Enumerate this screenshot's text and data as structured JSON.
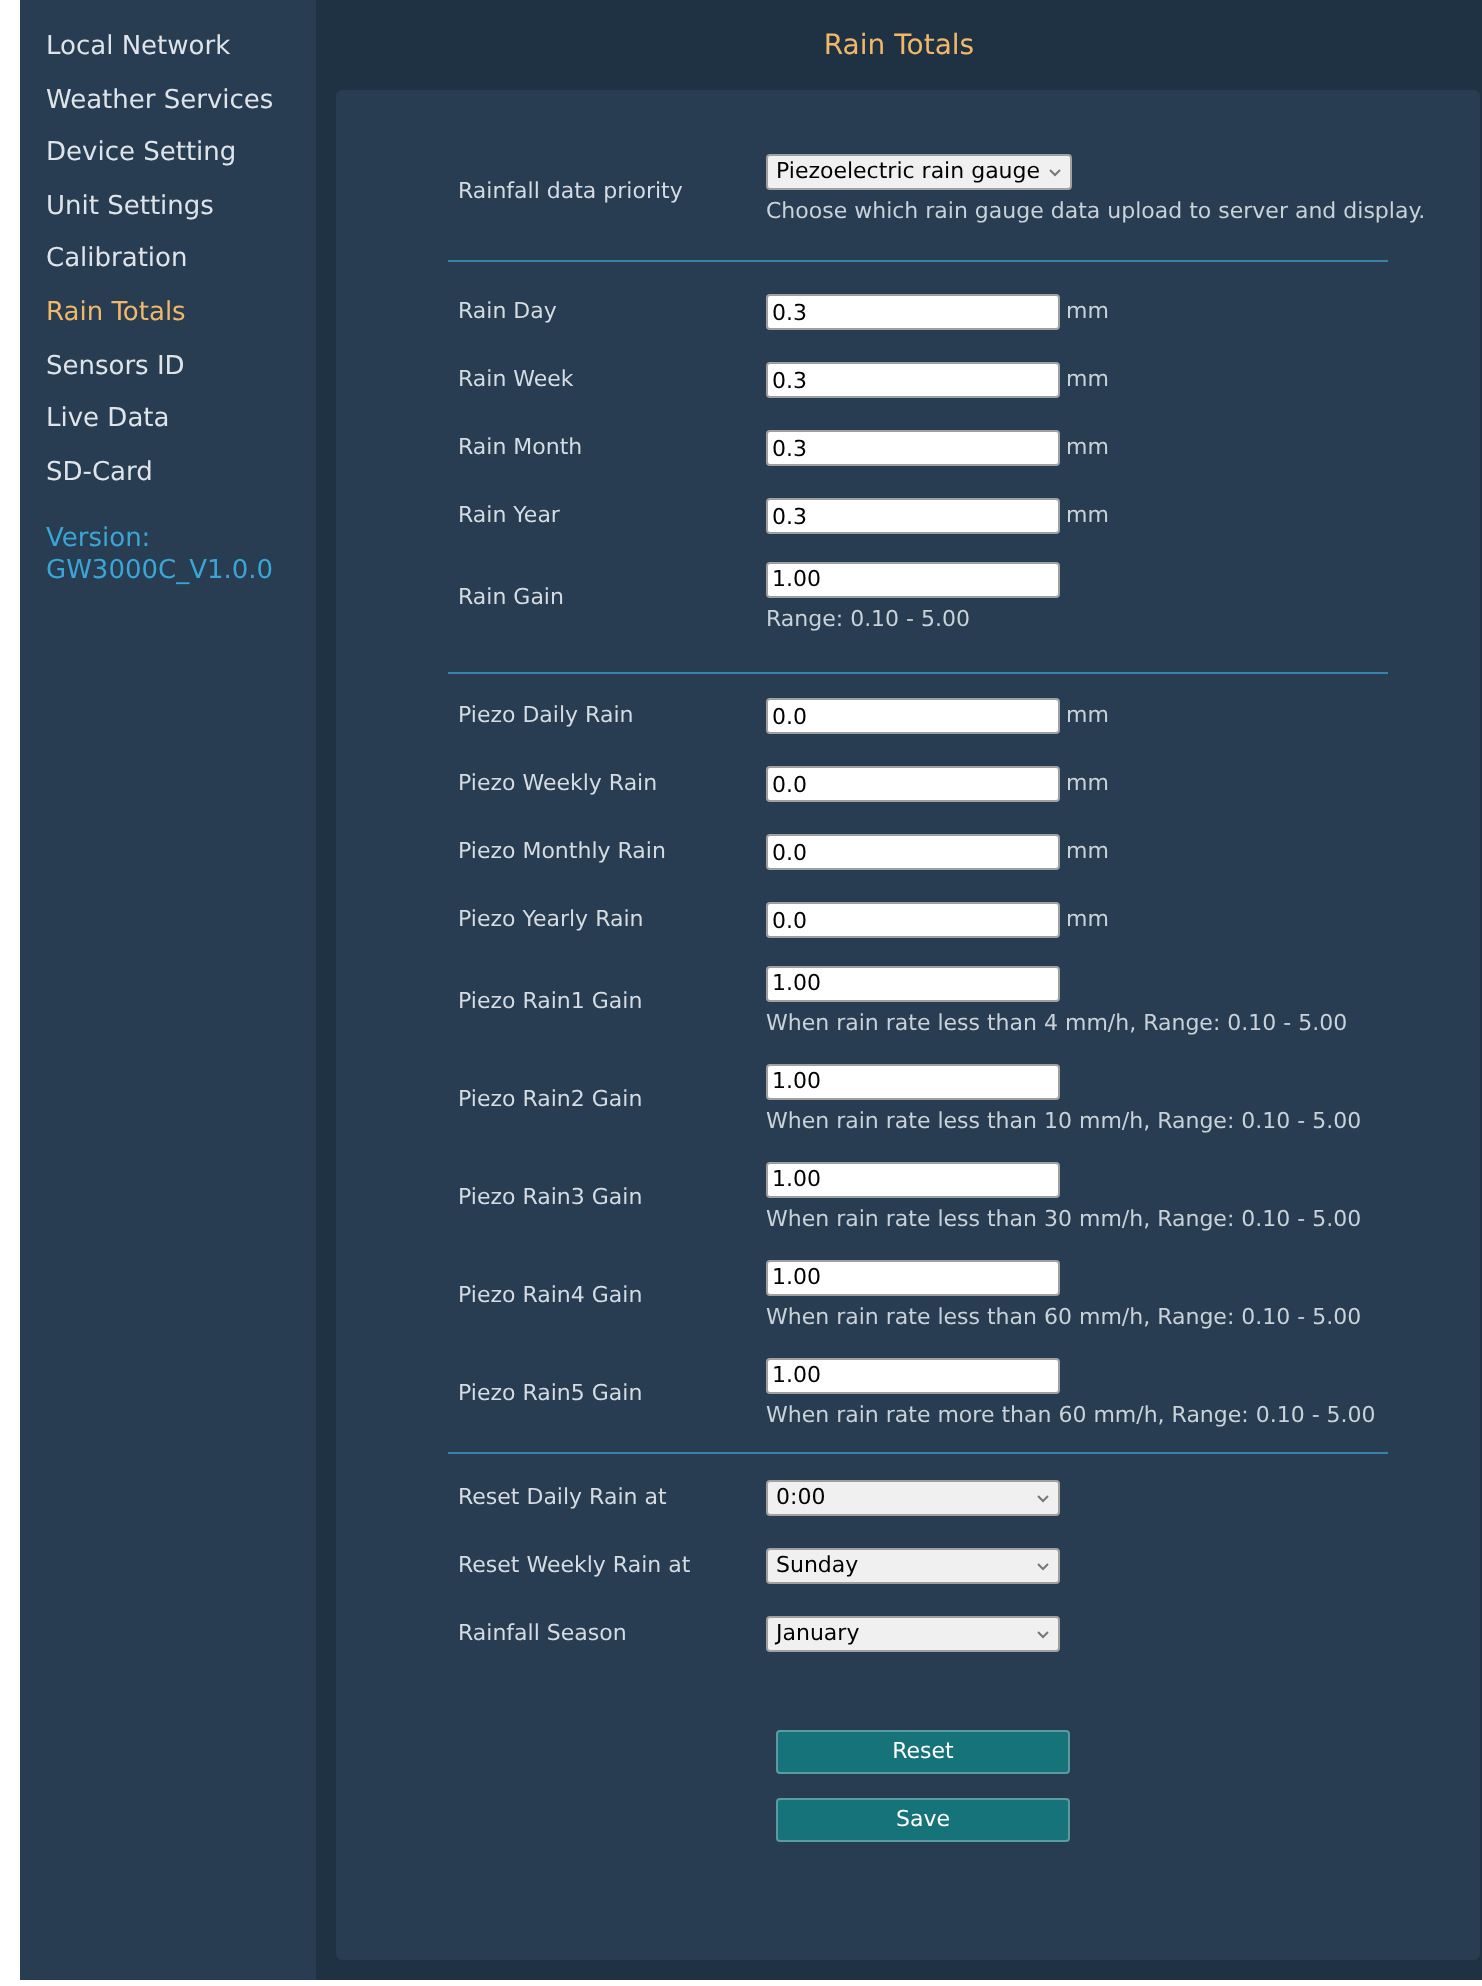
{
  "sidebar": {
    "items": [
      {
        "label": "Local Network",
        "selected": false
      },
      {
        "label": "Weather Services",
        "selected": false
      },
      {
        "label": "Device Setting",
        "selected": false
      },
      {
        "label": "Unit Settings",
        "selected": false
      },
      {
        "label": "Calibration",
        "selected": false
      },
      {
        "label": "Rain Totals",
        "selected": true
      },
      {
        "label": "Sensors ID",
        "selected": false
      },
      {
        "label": "Live Data",
        "selected": false
      },
      {
        "label": "SD-Card",
        "selected": false
      }
    ],
    "version_label": "Version:",
    "version": "GW3000C_V1.0.0"
  },
  "title": "Rain Totals",
  "sections": [
    {
      "rows": [
        {
          "kind": "select",
          "label": "Rainfall data priority",
          "value": "Piezoelectric rain gauge",
          "note": "Choose which rain gauge data upload to server and display."
        }
      ]
    },
    {
      "rows": [
        {
          "kind": "input",
          "label": "Rain Day",
          "value": "0.3",
          "unit": "mm"
        },
        {
          "kind": "input",
          "label": "Rain Week",
          "value": "0.3",
          "unit": "mm"
        },
        {
          "kind": "input",
          "label": "Rain Month",
          "value": "0.3",
          "unit": "mm"
        },
        {
          "kind": "input",
          "label": "Rain Year",
          "value": "0.3",
          "unit": "mm"
        },
        {
          "kind": "input",
          "label": "Rain Gain",
          "value": "1.00",
          "note": "Range: 0.10 - 5.00"
        }
      ]
    },
    {
      "rows": [
        {
          "kind": "input",
          "label": "Piezo Daily Rain",
          "value": "0.0",
          "unit": "mm"
        },
        {
          "kind": "input",
          "label": "Piezo Weekly Rain",
          "value": "0.0",
          "unit": "mm"
        },
        {
          "kind": "input",
          "label": "Piezo Monthly Rain",
          "value": "0.0",
          "unit": "mm"
        },
        {
          "kind": "input",
          "label": "Piezo Yearly Rain",
          "value": "0.0",
          "unit": "mm"
        },
        {
          "kind": "input",
          "label": "Piezo Rain1 Gain",
          "value": "1.00",
          "note": "When rain rate less than 4 mm/h, Range: 0.10 - 5.00"
        },
        {
          "kind": "input",
          "label": "Piezo Rain2 Gain",
          "value": "1.00",
          "note": "When rain rate less than 10 mm/h, Range: 0.10 - 5.00"
        },
        {
          "kind": "input",
          "label": "Piezo Rain3 Gain",
          "value": "1.00",
          "note": "When rain rate less than 30 mm/h, Range: 0.10 - 5.00"
        },
        {
          "kind": "input",
          "label": "Piezo Rain4 Gain",
          "value": "1.00",
          "note": "When rain rate less than 60 mm/h, Range: 0.10 - 5.00"
        },
        {
          "kind": "input",
          "label": "Piezo Rain5 Gain",
          "value": "1.00",
          "note": "When rain rate more than 60 mm/h, Range: 0.10 - 5.00"
        }
      ]
    },
    {
      "rows": [
        {
          "kind": "select",
          "label": "Reset Daily Rain at",
          "value": "0:00"
        },
        {
          "kind": "select",
          "label": "Reset Weekly Rain at",
          "value": "Sunday"
        },
        {
          "kind": "select",
          "label": "Rainfall Season",
          "value": "January"
        }
      ]
    }
  ],
  "buttons": [
    "Reset",
    "Save"
  ]
}
